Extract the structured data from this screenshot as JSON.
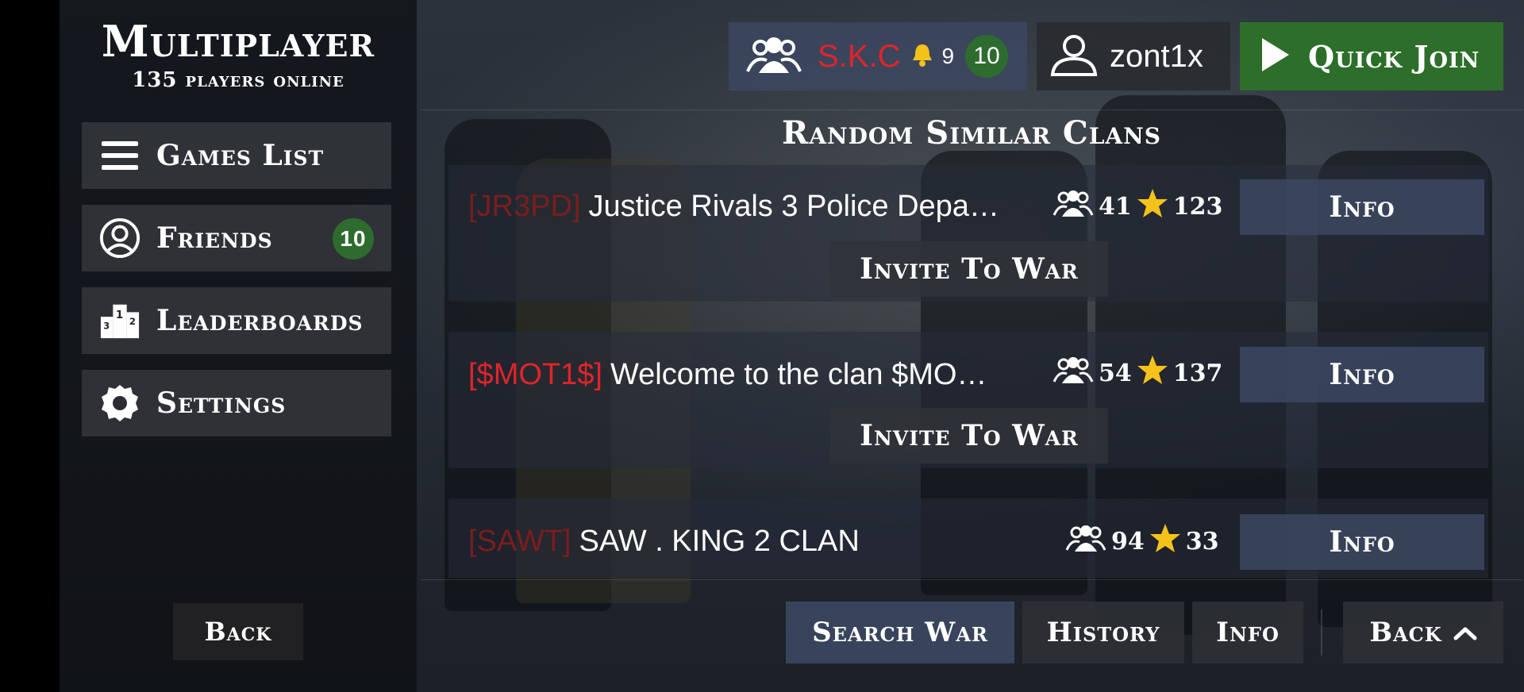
{
  "header": {
    "title": "Multiplayer",
    "subtitle": "135 players online"
  },
  "menu": {
    "items": [
      {
        "label": "Games List",
        "icon": "menu-icon"
      },
      {
        "label": "Friends",
        "icon": "person-icon",
        "badge": "10"
      },
      {
        "label": "Leaderboards",
        "icon": "podium-icon"
      },
      {
        "label": "Settings",
        "icon": "gear-icon"
      }
    ],
    "back_label": "Back"
  },
  "topbar": {
    "clan_name": "S.K.C",
    "bell_count": "9",
    "clan_badge": "10",
    "username": "zont1x",
    "quick_join_label": "Quick Join"
  },
  "section": {
    "title": "Random Similar Clans"
  },
  "clans": [
    {
      "tag": "[JR3PD]",
      "name": "Justice Rivals 3 Police Depa…",
      "members": "41",
      "stars": "123",
      "info_label": "Info",
      "war_label": "Invite To War"
    },
    {
      "tag": "[$MOT1$]",
      "name": "Welcome to the clan $MO…",
      "members": "54",
      "stars": "137",
      "info_label": "Info",
      "war_label": "Invite To War"
    },
    {
      "tag": "[SAWT]",
      "name": "SAW . KING 2 CLAN",
      "members": "94",
      "stars": "33",
      "info_label": "Info"
    }
  ],
  "bottom": {
    "search_war": "Search War",
    "history": "History",
    "info": "Info",
    "back": "Back"
  },
  "colors": {
    "clan_red": "#e0242a",
    "green": "#2c6e2a",
    "star": "#f5c21a",
    "panel_blue": "#3c4862"
  }
}
